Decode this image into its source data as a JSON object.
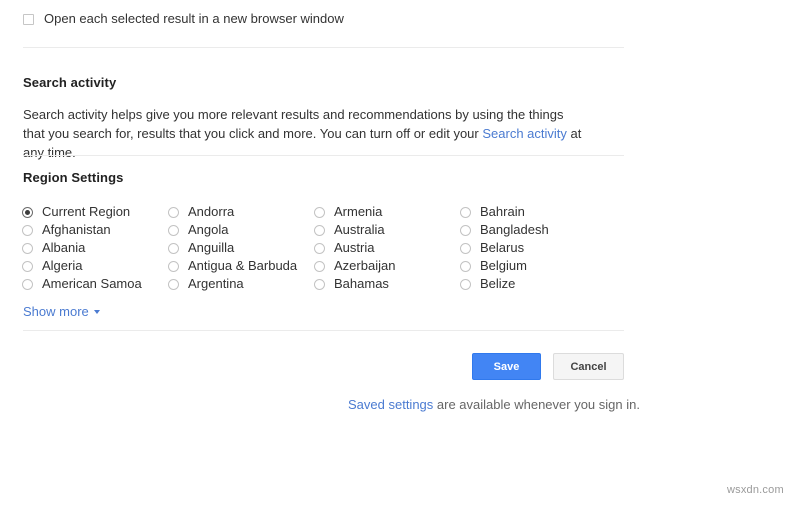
{
  "colors": {
    "link": "#4b7bd1",
    "primary_button_bg": "#4285f4",
    "primary_button_border": "#3079ed",
    "secondary_button_bg": "#f5f5f5",
    "secondary_button_border": "#dcdcdc",
    "divider": "#ebebeb",
    "body_text": "#333333",
    "muted_text": "#666666"
  },
  "new_window_option": {
    "label": "Open each selected result in a new browser window",
    "checked": false
  },
  "search_activity": {
    "heading": "Search activity",
    "description_before": "Search activity helps give you more relevant results and recommendations by using the things that you search for, results that you click and more. You can turn off or edit your ",
    "link_text": "Search activity",
    "description_after": " at any time."
  },
  "region_settings": {
    "heading": "Region Settings",
    "selected": "Current Region",
    "columns": [
      [
        "Current Region",
        "Afghanistan",
        "Albania",
        "Algeria",
        "American Samoa"
      ],
      [
        "Andorra",
        "Angola",
        "Anguilla",
        "Antigua & Barbuda",
        "Argentina"
      ],
      [
        "Armenia",
        "Australia",
        "Austria",
        "Azerbaijan",
        "Bahamas"
      ],
      [
        "Bahrain",
        "Bangladesh",
        "Belarus",
        "Belgium",
        "Belize"
      ]
    ],
    "show_more_label": "Show more",
    "show_more_icon": "chevron-down-icon"
  },
  "actions": {
    "save_label": "Save",
    "cancel_label": "Cancel"
  },
  "footer": {
    "saved_settings_link": "Saved settings",
    "saved_settings_rest": " are available whenever you sign in."
  },
  "watermark": {
    "text": "wsxdn.com"
  }
}
